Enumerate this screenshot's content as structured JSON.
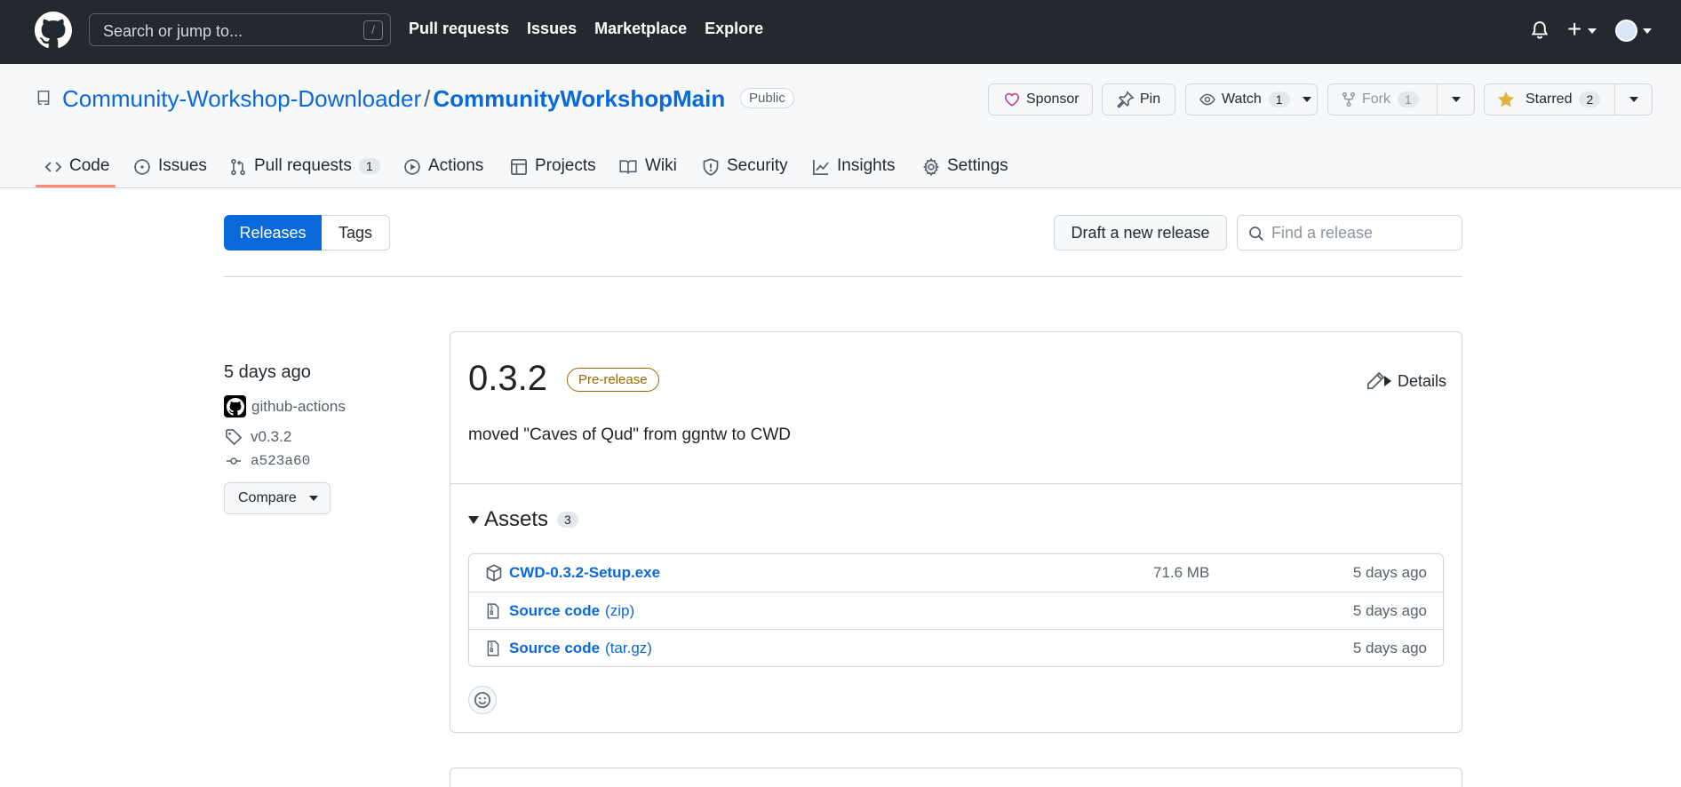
{
  "header": {
    "search_placeholder": "Search or jump to...",
    "slash_key": "/",
    "nav": [
      "Pull requests",
      "Issues",
      "Marketplace",
      "Explore"
    ]
  },
  "repo": {
    "owner": "Community-Workshop-Downloader",
    "separator": "/",
    "name": "CommunityWorkshopMain",
    "visibility": "Public",
    "sponsor_label": "Sponsor",
    "pin_label": "Pin",
    "watch_label": "Watch",
    "watch_count": "1",
    "fork_label": "Fork",
    "fork_count": "1",
    "star_label": "Starred",
    "star_count": "2"
  },
  "tabs": [
    {
      "label": "Code",
      "icon": "code-icon"
    },
    {
      "label": "Issues",
      "icon": "issue-icon"
    },
    {
      "label": "Pull requests",
      "icon": "pull-request-icon",
      "count": "1"
    },
    {
      "label": "Actions",
      "icon": "play-icon"
    },
    {
      "label": "Projects",
      "icon": "table-icon"
    },
    {
      "label": "Wiki",
      "icon": "book-icon"
    },
    {
      "label": "Security",
      "icon": "shield-icon"
    },
    {
      "label": "Insights",
      "icon": "graph-icon"
    },
    {
      "label": "Settings",
      "icon": "gear-icon"
    }
  ],
  "releases_nav": {
    "releases_label": "Releases",
    "tags_label": "Tags",
    "draft_label": "Draft a new release",
    "find_placeholder": "Find a release"
  },
  "release": {
    "time_ago": "5 days ago",
    "author": "github-actions",
    "tag": "v0.3.2",
    "commit": "a523a60",
    "compare_label": "Compare",
    "title": "0.3.2",
    "badge": "Pre-release",
    "details_label": "Details",
    "body": "moved \"Caves of Qud\" from ggntw to CWD",
    "assets_label": "Assets",
    "assets_count": "3",
    "assets": [
      {
        "name": "CWD-0.3.2-Setup.exe",
        "ext": "",
        "size": "71.6 MB",
        "date": "5 days ago",
        "icon": "package-icon"
      },
      {
        "name": "Source code",
        "ext": "(zip)",
        "size": "",
        "date": "5 days ago",
        "icon": "file-zip-icon"
      },
      {
        "name": "Source code",
        "ext": "(tar.gz)",
        "size": "",
        "date": "5 days ago",
        "icon": "file-zip-icon"
      }
    ]
  },
  "colors": {
    "header_bg": "#24292f",
    "link": "#0969da",
    "accent_underline": "#fd8c73",
    "prerelease": "#9a6700",
    "primary_button": "#0969da"
  }
}
